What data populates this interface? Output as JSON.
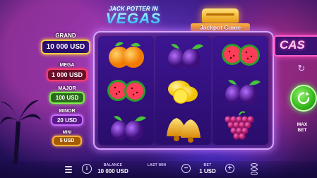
{
  "title": {
    "line1": "JACK POTTER IN",
    "line2": "VEGAS"
  },
  "jackpot_game": {
    "label": "Jackpot Game"
  },
  "jackpots": {
    "grand": {
      "name": "GRAND",
      "value": "10 000 USD"
    },
    "mega": {
      "name": "MEGA",
      "value": "1 000 USD"
    },
    "major": {
      "name": "MAJOR",
      "value": "100 USD"
    },
    "minor": {
      "name": "MINOR",
      "value": "20 USD"
    },
    "mini": {
      "name": "MINI",
      "value": "5 USD"
    }
  },
  "reels": [
    [
      "orange",
      "watermelon",
      "plum"
    ],
    [
      "plum",
      "lemon",
      "bell"
    ],
    [
      "watermelon",
      "plum",
      "grapes"
    ]
  ],
  "sign": {
    "text": "CAS"
  },
  "controls": {
    "max_bet_line1": "MAX",
    "max_bet_line2": "BET"
  },
  "bottom_bar": {
    "balance_label": "BALANCE",
    "balance_value": "10 000 USD",
    "last_win_label": "LAST WIN",
    "last_win_value": "",
    "bet_label": "BET",
    "bet_value": "1 USD"
  },
  "icons": {
    "menu": "menu-icon",
    "info": "info-icon",
    "minus": "minus-icon",
    "plus": "plus-icon",
    "coins": "coins-icon",
    "autoplay": "autoplay-icon",
    "spin": "spin-icon"
  },
  "colors": {
    "spin_green": "#34b61d",
    "frame_glow": "#c67cff",
    "grand_gold": "#ffcf3a"
  }
}
